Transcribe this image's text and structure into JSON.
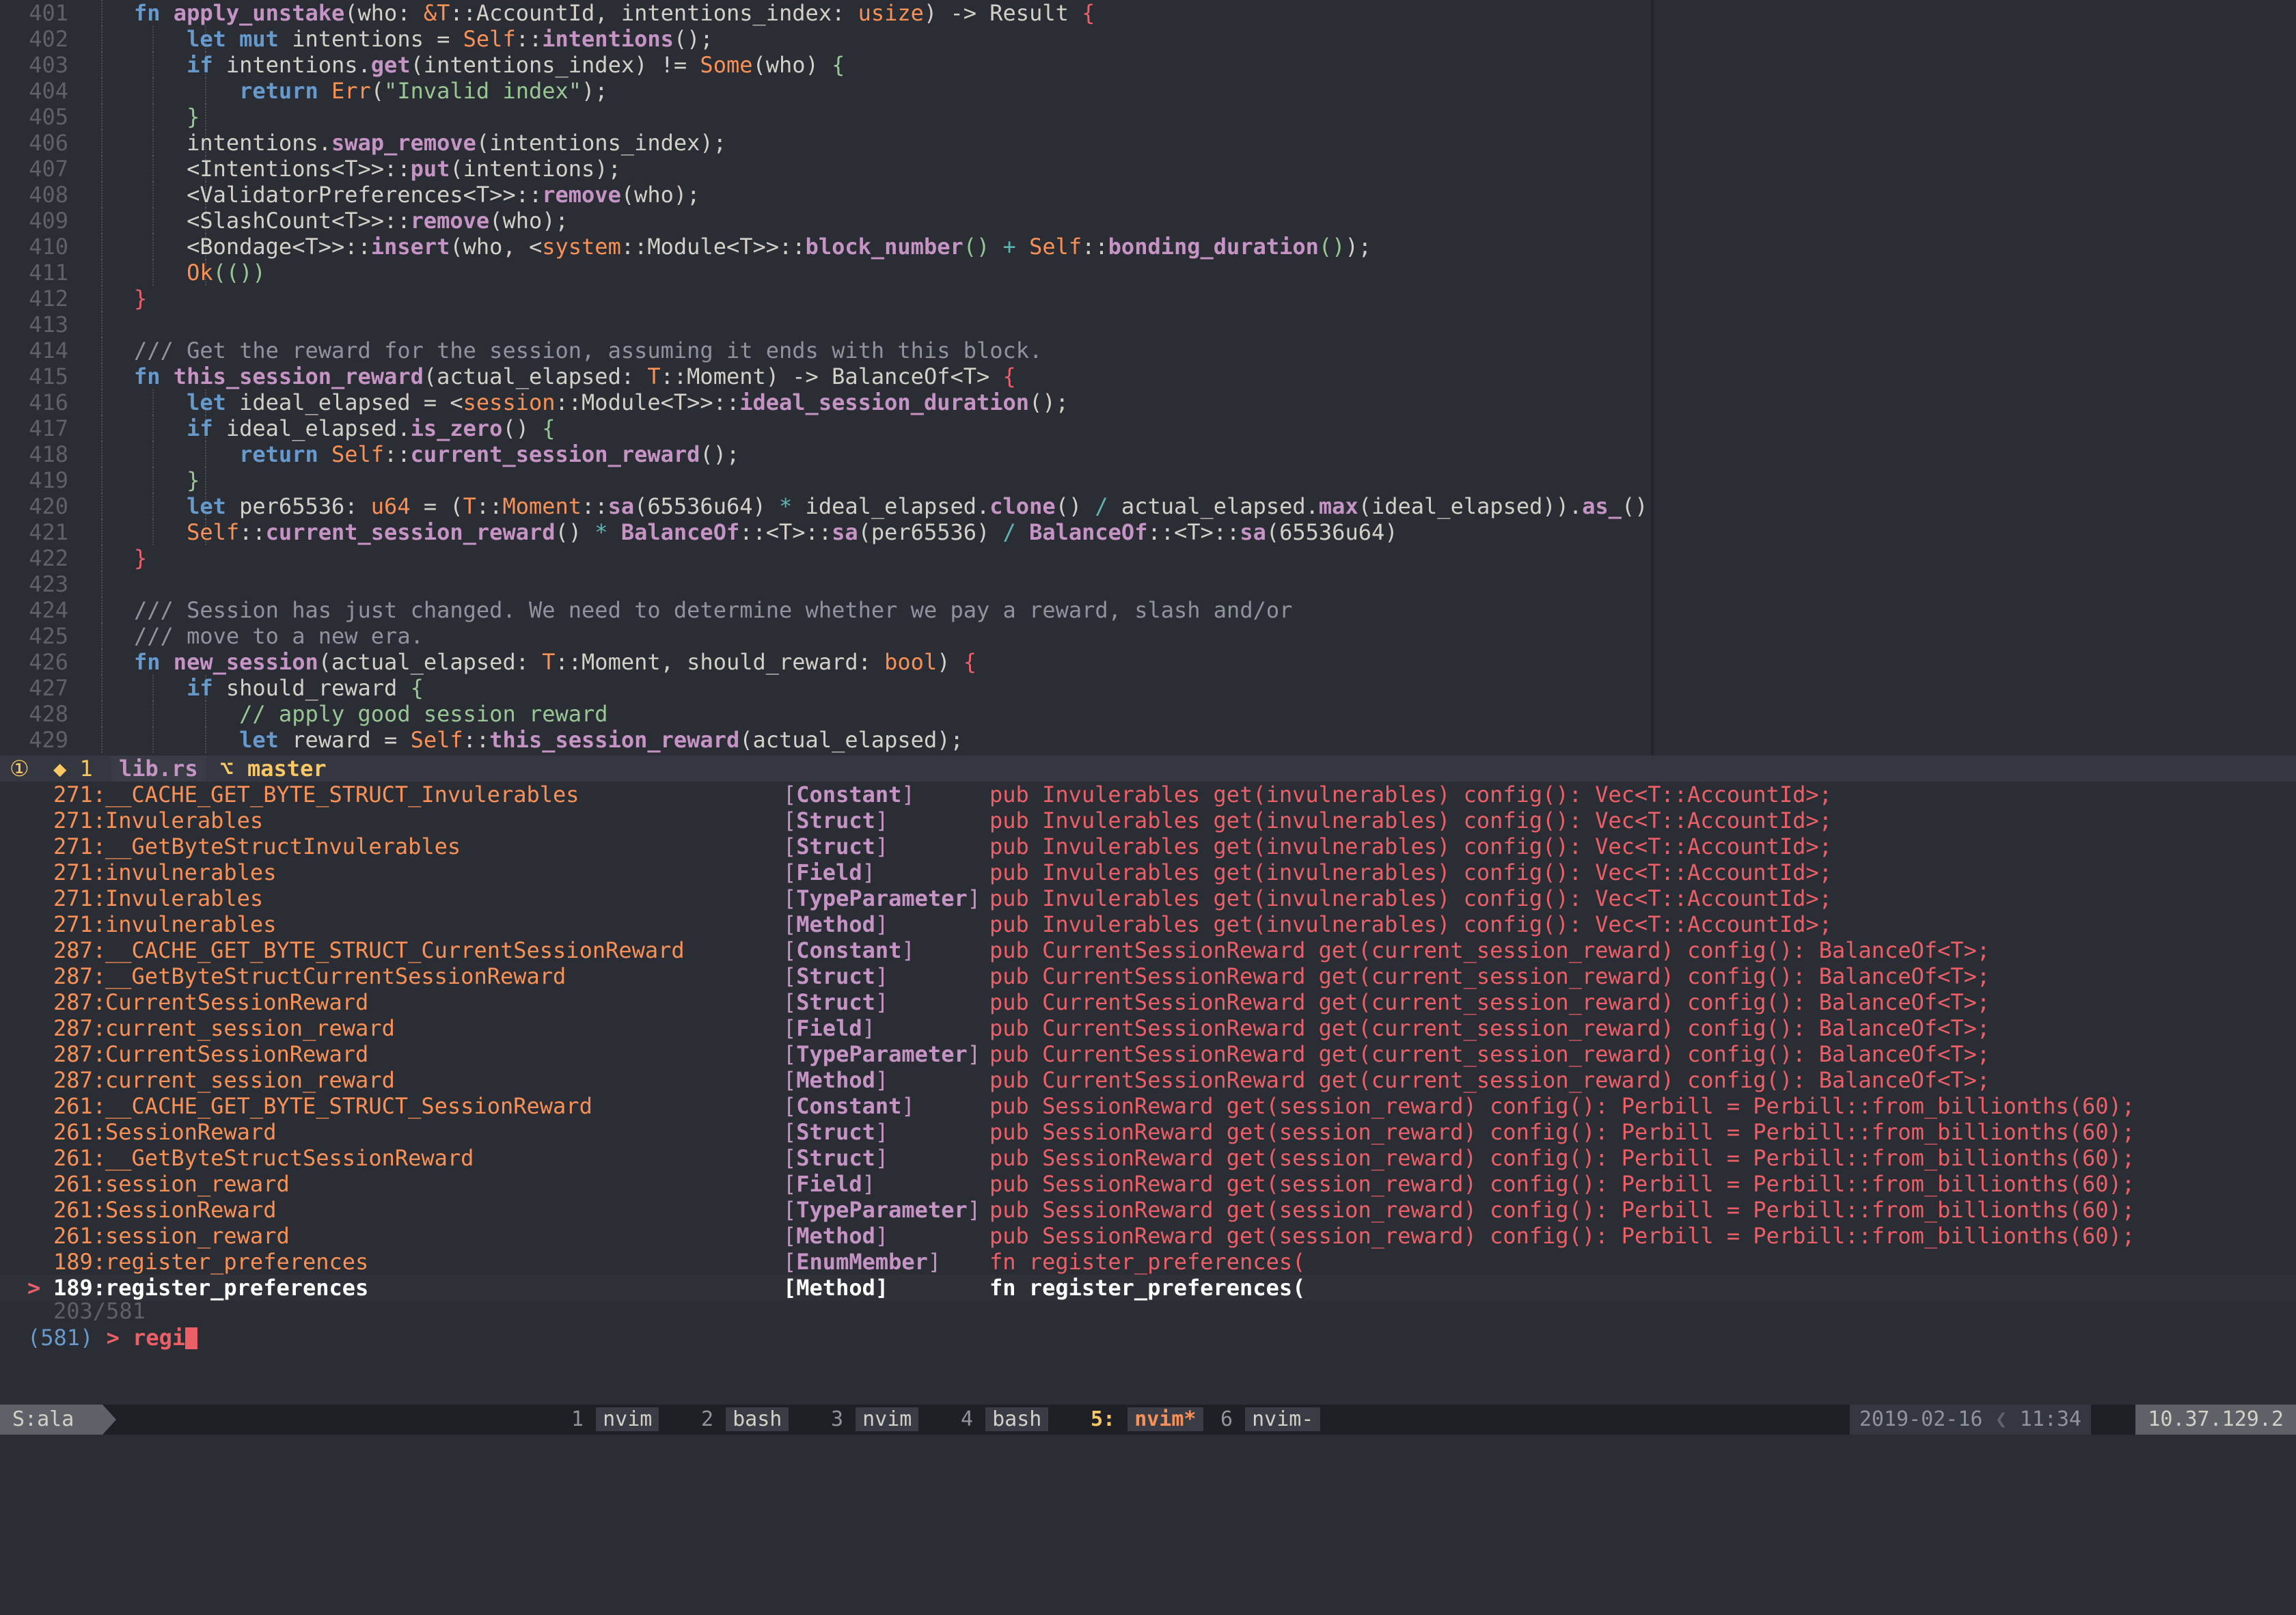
{
  "editor": {
    "lines": [
      {
        "n": "401",
        "segs": [
          [
            "kw",
            "fn "
          ],
          [
            "fn",
            "apply_unstake"
          ],
          [
            "pl",
            "(who: "
          ],
          [
            "ty",
            "&T"
          ],
          [
            "pl",
            "::AccountId, intentions_index: "
          ],
          [
            "ty",
            "usize"
          ],
          [
            "pl",
            ") -> "
          ],
          [
            "pl",
            "Result"
          ],
          [
            "pl",
            " "
          ],
          [
            "br",
            "{"
          ]
        ]
      },
      {
        "n": "402",
        "segs": [
          [
            "pl",
            "    "
          ],
          [
            "kw",
            "let mut "
          ],
          [
            "pl",
            "intentions = "
          ],
          [
            "ty",
            "Self"
          ],
          [
            "pl",
            "::"
          ],
          [
            "fn",
            "intentions"
          ],
          [
            "pl",
            "();"
          ]
        ]
      },
      {
        "n": "403",
        "segs": [
          [
            "pl",
            "    "
          ],
          [
            "kw",
            "if "
          ],
          [
            "pl",
            "intentions."
          ],
          [
            "fn",
            "get"
          ],
          [
            "pl",
            "(intentions_index) != "
          ],
          [
            "ty",
            "Some"
          ],
          [
            "pl",
            "(who) "
          ],
          [
            "br2",
            "{"
          ]
        ]
      },
      {
        "n": "404",
        "segs": [
          [
            "pl",
            "        "
          ],
          [
            "kw",
            "return "
          ],
          [
            "ok",
            "Err"
          ],
          [
            "pl",
            "("
          ],
          [
            "str",
            "\"Invalid index\""
          ],
          [
            "pl",
            ");"
          ]
        ]
      },
      {
        "n": "405",
        "segs": [
          [
            "pl",
            "    "
          ],
          [
            "br2",
            "}"
          ]
        ]
      },
      {
        "n": "406",
        "segs": [
          [
            "pl",
            "    intentions."
          ],
          [
            "fn",
            "swap_remove"
          ],
          [
            "pl",
            "(intentions_index);"
          ]
        ]
      },
      {
        "n": "407",
        "segs": [
          [
            "pl",
            "    <Intentions<T>>::"
          ],
          [
            "fn",
            "put"
          ],
          [
            "pl",
            "(intentions);"
          ]
        ]
      },
      {
        "n": "408",
        "segs": [
          [
            "pl",
            "    <ValidatorPreferences<T>>::"
          ],
          [
            "fn",
            "remove"
          ],
          [
            "pl",
            "(who);"
          ]
        ]
      },
      {
        "n": "409",
        "segs": [
          [
            "pl",
            "    <SlashCount<T>>::"
          ],
          [
            "fn",
            "remove"
          ],
          [
            "pl",
            "(who);"
          ]
        ]
      },
      {
        "n": "410",
        "segs": [
          [
            "pl",
            "    <Bondage<T>>::"
          ],
          [
            "fn",
            "insert"
          ],
          [
            "pl",
            "(who, <"
          ],
          [
            "mac",
            "system"
          ],
          [
            "pl",
            "::Module<T>>::"
          ],
          [
            "fn",
            "block_number"
          ],
          [
            "br2",
            "()"
          ],
          [
            "pl",
            " "
          ],
          [
            "op",
            "+"
          ],
          [
            "pl",
            " "
          ],
          [
            "ty",
            "Self"
          ],
          [
            "pl",
            "::"
          ],
          [
            "fn",
            "bonding_duration"
          ],
          [
            "br2",
            "()"
          ],
          [
            "pl",
            ");"
          ]
        ]
      },
      {
        "n": "411",
        "segs": [
          [
            "pl",
            "    "
          ],
          [
            "ok",
            "Ok"
          ],
          [
            "br2",
            "(())"
          ]
        ]
      },
      {
        "n": "412",
        "segs": [
          [
            "br",
            "}"
          ]
        ]
      },
      {
        "n": "413",
        "segs": []
      },
      {
        "n": "414",
        "segs": [
          [
            "cm",
            "/// Get the reward for the session, assuming it ends with this block."
          ]
        ]
      },
      {
        "n": "415",
        "segs": [
          [
            "kw",
            "fn "
          ],
          [
            "fn",
            "this_session_reward"
          ],
          [
            "pl",
            "(actual_elapsed: "
          ],
          [
            "ty",
            "T"
          ],
          [
            "pl",
            "::Moment) -> BalanceOf<T> "
          ],
          [
            "br",
            "{"
          ]
        ]
      },
      {
        "n": "416",
        "segs": [
          [
            "pl",
            "    "
          ],
          [
            "kw",
            "let "
          ],
          [
            "pl",
            "ideal_elapsed = <"
          ],
          [
            "mac",
            "session"
          ],
          [
            "pl",
            "::Module<T>>::"
          ],
          [
            "fn",
            "ideal_session_duration"
          ],
          [
            "pl",
            "();"
          ]
        ]
      },
      {
        "n": "417",
        "segs": [
          [
            "pl",
            "    "
          ],
          [
            "kw",
            "if "
          ],
          [
            "pl",
            "ideal_elapsed."
          ],
          [
            "fn",
            "is_zero"
          ],
          [
            "pl",
            "() "
          ],
          [
            "br2",
            "{"
          ]
        ]
      },
      {
        "n": "418",
        "segs": [
          [
            "pl",
            "        "
          ],
          [
            "kw",
            "return "
          ],
          [
            "ty",
            "Self"
          ],
          [
            "pl",
            "::"
          ],
          [
            "fn",
            "current_session_reward"
          ],
          [
            "pl",
            "();"
          ]
        ]
      },
      {
        "n": "419",
        "segs": [
          [
            "pl",
            "    "
          ],
          [
            "br2",
            "}"
          ]
        ]
      },
      {
        "n": "420",
        "segs": [
          [
            "pl",
            "    "
          ],
          [
            "kw",
            "let "
          ],
          [
            "pl",
            "per65536: "
          ],
          [
            "ty",
            "u64"
          ],
          [
            "pl",
            " = ("
          ],
          [
            "ty",
            "T"
          ],
          [
            "pl",
            "::"
          ],
          [
            "mac",
            "Moment"
          ],
          [
            "pl",
            "::"
          ],
          [
            "fn",
            "sa"
          ],
          [
            "pl",
            "(65536u64) "
          ],
          [
            "op",
            "*"
          ],
          [
            "pl",
            " ideal_elapsed."
          ],
          [
            "fn",
            "clone"
          ],
          [
            "pl",
            "() "
          ],
          [
            "op",
            "/"
          ],
          [
            "pl",
            " actual_elapsed."
          ],
          [
            "fn",
            "max"
          ],
          [
            "pl",
            "(ideal_elapsed))."
          ],
          [
            "fn",
            "as_"
          ],
          [
            "pl",
            "();"
          ]
        ]
      },
      {
        "n": "421",
        "segs": [
          [
            "pl",
            "    "
          ],
          [
            "ty",
            "Self"
          ],
          [
            "pl",
            "::"
          ],
          [
            "fn",
            "current_session_reward"
          ],
          [
            "pl",
            "() "
          ],
          [
            "op",
            "*"
          ],
          [
            "pl",
            " "
          ],
          [
            "fn",
            "BalanceOf"
          ],
          [
            "pl",
            "::<T>::"
          ],
          [
            "fn",
            "sa"
          ],
          [
            "pl",
            "(per65536) "
          ],
          [
            "op",
            "/"
          ],
          [
            "pl",
            " "
          ],
          [
            "fn",
            "BalanceOf"
          ],
          [
            "pl",
            "::<T>::"
          ],
          [
            "fn",
            "sa"
          ],
          [
            "pl",
            "(65536u64)"
          ]
        ]
      },
      {
        "n": "422",
        "segs": [
          [
            "br",
            "}"
          ]
        ]
      },
      {
        "n": "423",
        "segs": []
      },
      {
        "n": "424",
        "segs": [
          [
            "cm",
            "/// Session has just changed. We need to determine whether we pay a reward, slash and/or"
          ]
        ]
      },
      {
        "n": "425",
        "segs": [
          [
            "cm",
            "/// move to a new era."
          ]
        ]
      },
      {
        "n": "426",
        "segs": [
          [
            "kw",
            "fn "
          ],
          [
            "fn",
            "new_session"
          ],
          [
            "pl",
            "(actual_elapsed: "
          ],
          [
            "ty",
            "T"
          ],
          [
            "pl",
            "::Moment, should_reward: "
          ],
          [
            "ty",
            "bool"
          ],
          [
            "pl",
            ") "
          ],
          [
            "br",
            "{"
          ]
        ]
      },
      {
        "n": "427",
        "segs": [
          [
            "pl",
            "    "
          ],
          [
            "kw",
            "if "
          ],
          [
            "pl",
            "should_reward "
          ],
          [
            "br2",
            "{"
          ]
        ]
      },
      {
        "n": "428",
        "segs": [
          [
            "pl",
            "        "
          ],
          [
            "cmi",
            "// apply good session reward"
          ]
        ]
      },
      {
        "n": "429",
        "segs": [
          [
            "pl",
            "        "
          ],
          [
            "kw",
            "let "
          ],
          [
            "pl",
            "reward = "
          ],
          [
            "ty",
            "Self"
          ],
          [
            "pl",
            "::"
          ],
          [
            "fn",
            "this_session_reward"
          ],
          [
            "pl",
            "(actual_elapsed);"
          ]
        ]
      }
    ]
  },
  "statusline": {
    "diagnostics_info": "①",
    "diagnostics_warn": "◆ 1",
    "filename": "lib.rs",
    "branch_icon": "git-branch-icon",
    "branch_glyph": "⌥",
    "branch": "master"
  },
  "results": [
    {
      "line": "271",
      "symbol": "__CACHE_GET_BYTE_STRUCT_Invulerables",
      "kind": "Constant",
      "code": "pub Invulerables get(invulnerables) config(): Vec<T::AccountId>;"
    },
    {
      "line": "271",
      "symbol": "Invulerables",
      "kind": "Struct",
      "code": "pub Invulerables get(invulnerables) config(): Vec<T::AccountId>;"
    },
    {
      "line": "271",
      "symbol": "__GetByteStructInvulerables",
      "kind": "Struct",
      "code": "pub Invulerables get(invulnerables) config(): Vec<T::AccountId>;"
    },
    {
      "line": "271",
      "symbol": "invulnerables",
      "kind": "Field",
      "code": "pub Invulerables get(invulnerables) config(): Vec<T::AccountId>;"
    },
    {
      "line": "271",
      "symbol": "Invulerables",
      "kind": "TypeParameter",
      "code": "pub Invulerables get(invulnerables) config(): Vec<T::AccountId>;"
    },
    {
      "line": "271",
      "symbol": "invulnerables",
      "kind": "Method",
      "code": "pub Invulerables get(invulnerables) config(): Vec<T::AccountId>;"
    },
    {
      "line": "287",
      "symbol": "__CACHE_GET_BYTE_STRUCT_CurrentSessionReward",
      "kind": "Constant",
      "code": "pub CurrentSessionReward get(current_session_reward) config(): BalanceOf<T>;"
    },
    {
      "line": "287",
      "symbol": "__GetByteStructCurrentSessionReward",
      "kind": "Struct",
      "code": "pub CurrentSessionReward get(current_session_reward) config(): BalanceOf<T>;"
    },
    {
      "line": "287",
      "symbol": "CurrentSessionReward",
      "kind": "Struct",
      "code": "pub CurrentSessionReward get(current_session_reward) config(): BalanceOf<T>;"
    },
    {
      "line": "287",
      "symbol": "current_session_reward",
      "kind": "Field",
      "code": "pub CurrentSessionReward get(current_session_reward) config(): BalanceOf<T>;"
    },
    {
      "line": "287",
      "symbol": "CurrentSessionReward",
      "kind": "TypeParameter",
      "code": "pub CurrentSessionReward get(current_session_reward) config(): BalanceOf<T>;"
    },
    {
      "line": "287",
      "symbol": "current_session_reward",
      "kind": "Method",
      "code": "pub CurrentSessionReward get(current_session_reward) config(): BalanceOf<T>;"
    },
    {
      "line": "261",
      "symbol": "__CACHE_GET_BYTE_STRUCT_SessionReward",
      "kind": "Constant",
      "code": "pub SessionReward get(session_reward) config(): Perbill = Perbill::from_billionths(60);"
    },
    {
      "line": "261",
      "symbol": "SessionReward",
      "kind": "Struct",
      "code": "pub SessionReward get(session_reward) config(): Perbill = Perbill::from_billionths(60);"
    },
    {
      "line": "261",
      "symbol": "__GetByteStructSessionReward",
      "kind": "Struct",
      "code": "pub SessionReward get(session_reward) config(): Perbill = Perbill::from_billionths(60);"
    },
    {
      "line": "261",
      "symbol": "session_reward",
      "kind": "Field",
      "code": "pub SessionReward get(session_reward) config(): Perbill = Perbill::from_billionths(60);"
    },
    {
      "line": "261",
      "symbol": "SessionReward",
      "kind": "TypeParameter",
      "code": "pub SessionReward get(session_reward) config(): Perbill = Perbill::from_billionths(60);"
    },
    {
      "line": "261",
      "symbol": "session_reward",
      "kind": "Method",
      "code": "pub SessionReward get(session_reward) config(): Perbill = Perbill::from_billionths(60);"
    },
    {
      "line": "189",
      "symbol": "register_preferences",
      "kind": "EnumMember",
      "code": "fn register_preferences("
    },
    {
      "line": "189",
      "symbol": "register_preferences",
      "kind": "Method",
      "code": "fn register_preferences(",
      "selected": true
    }
  ],
  "picker": {
    "pointer": ">",
    "counter": "203/581",
    "prompt_count": "(581)",
    "prompt_symbol": ">",
    "query": "regi"
  },
  "tmux": {
    "session": "S:ala",
    "windows": [
      {
        "num": "1",
        "name": "nvim"
      },
      {
        "num": "2",
        "name": "bash"
      },
      {
        "num": "3",
        "name": "nvim"
      },
      {
        "num": "4",
        "name": "bash"
      },
      {
        "num": "5:",
        "name": "nvim*",
        "active": true
      },
      {
        "num": "6",
        "name": "nvim-"
      }
    ],
    "date": "2019-02-16",
    "time": "11:34",
    "ip": "10.37.129.2"
  },
  "colors": {
    "background": "#2b2d35",
    "keyword": "#6699cc",
    "function": "#c594c5",
    "type": "#f99157",
    "string": "#99c794",
    "error_red": "#ec5f67",
    "accent_yellow": "#fac863"
  }
}
